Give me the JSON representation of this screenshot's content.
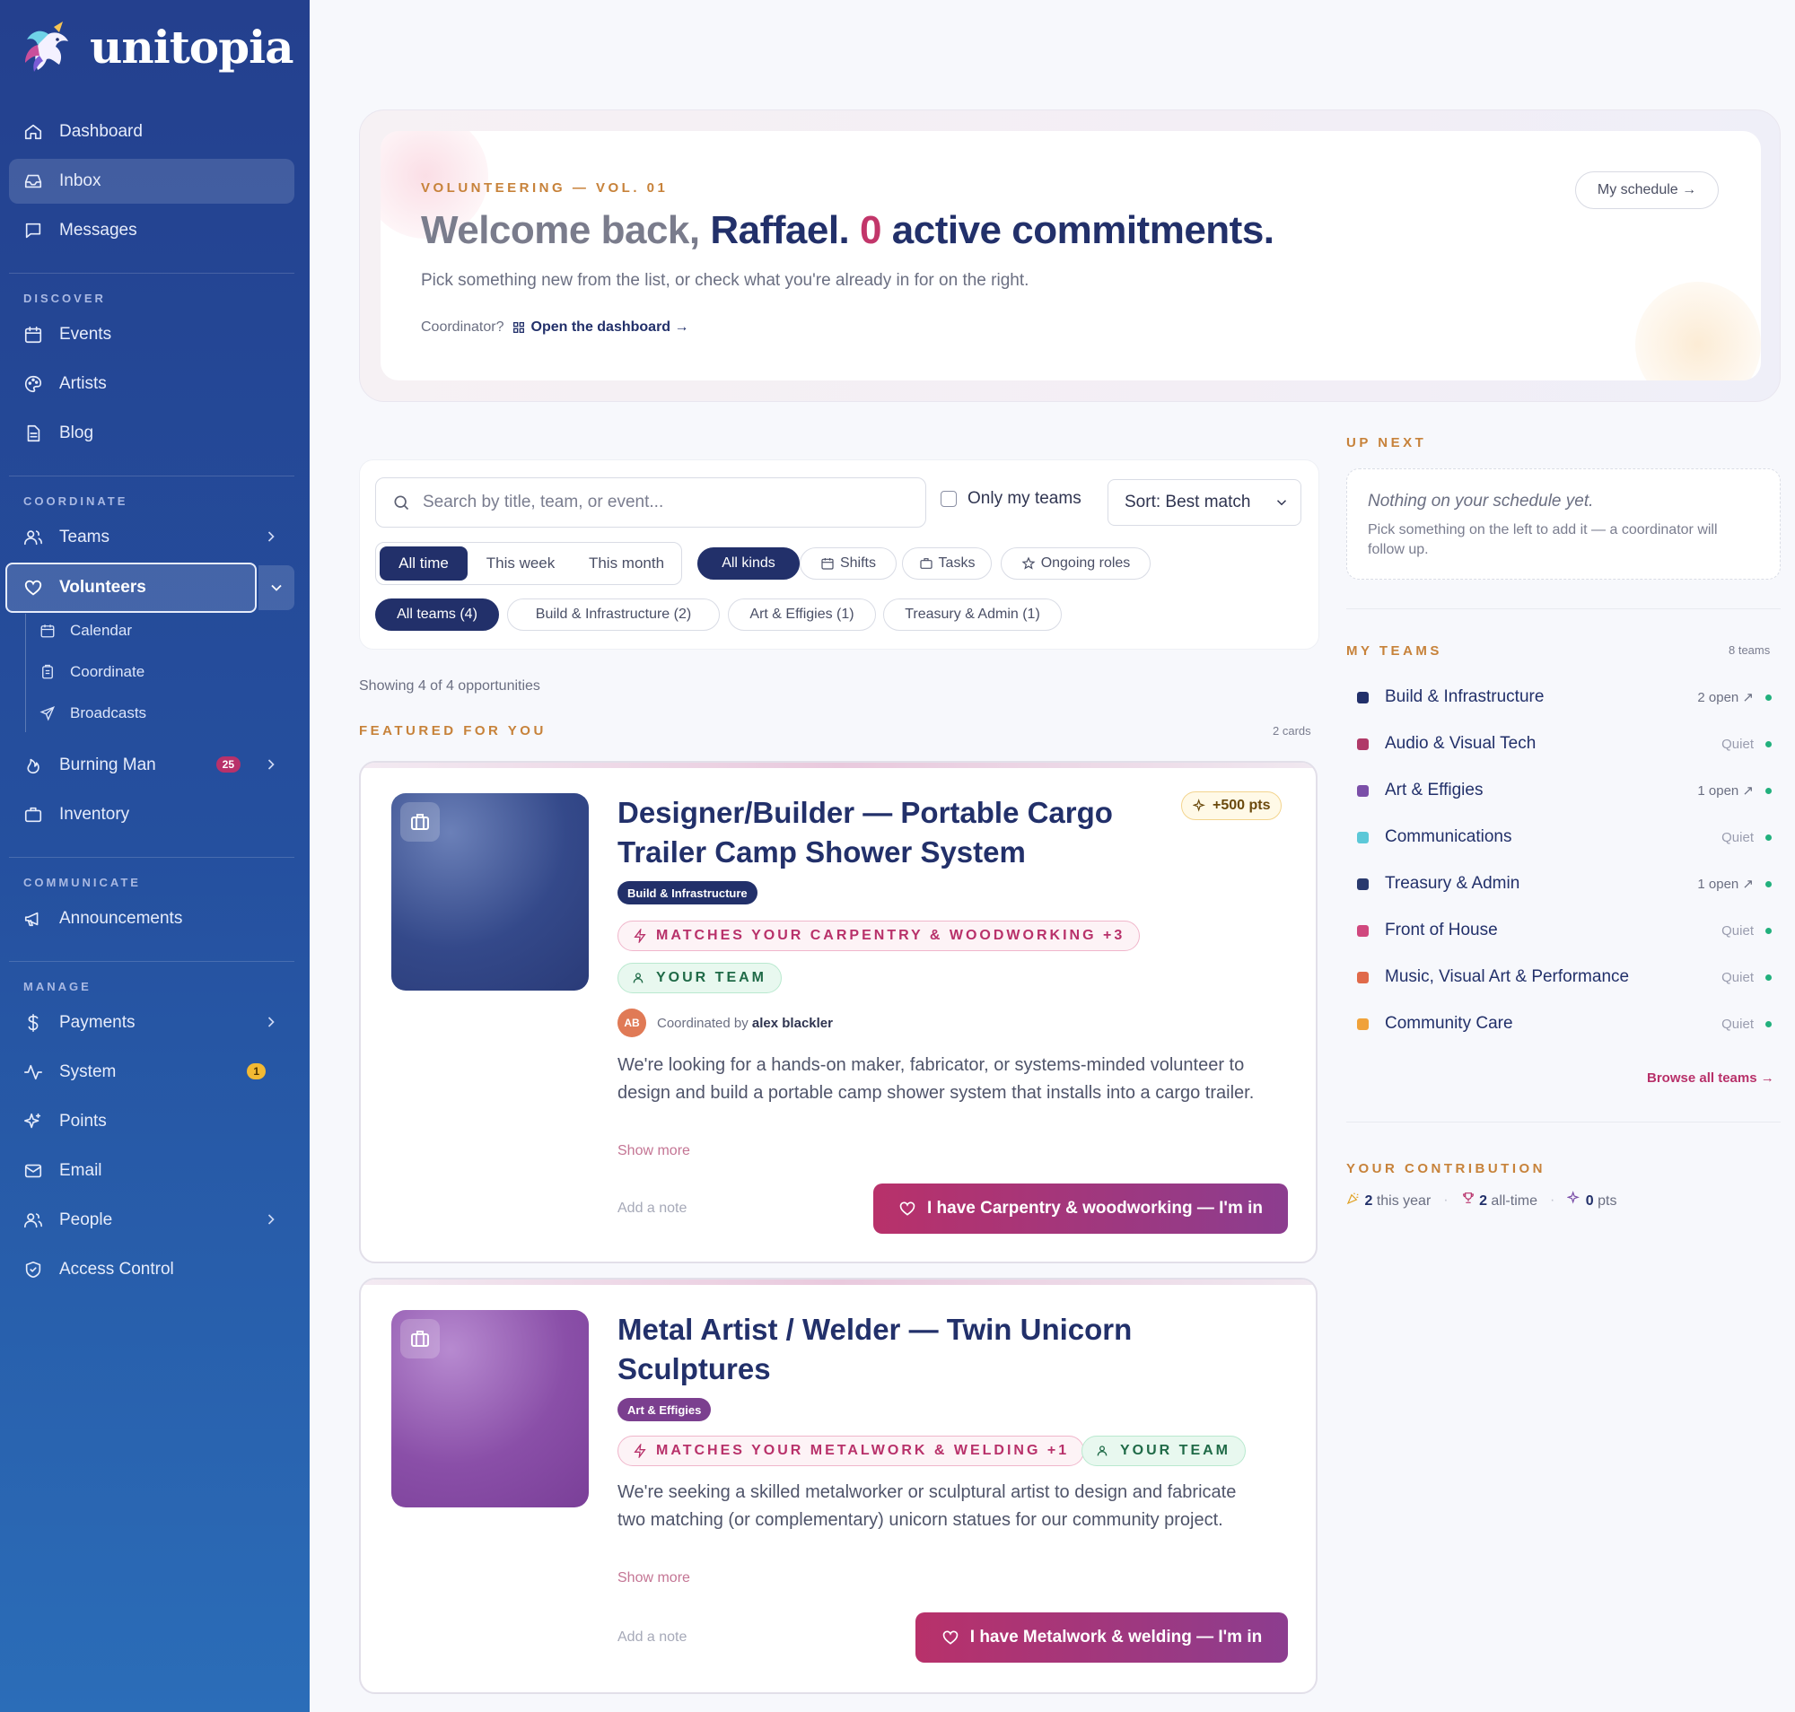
{
  "brand": {
    "name": "unitopia"
  },
  "sidebar": {
    "top": [
      {
        "label": "Dashboard",
        "icon": "home-icon"
      },
      {
        "label": "Inbox",
        "icon": "inbox-icon"
      },
      {
        "label": "Messages",
        "icon": "message-icon"
      }
    ],
    "sections": {
      "discover": "DISCOVER",
      "coordinate": "COORDINATE",
      "communicate": "COMMUNICATE",
      "manage": "MANAGE"
    },
    "discover": [
      {
        "label": "Events",
        "icon": "calendar-icon"
      },
      {
        "label": "Artists",
        "icon": "palette-icon"
      },
      {
        "label": "Blog",
        "icon": "document-icon"
      }
    ],
    "coordinate": {
      "teams": "Teams",
      "volunteers": "Volunteers",
      "sub": [
        "Calendar",
        "Coordinate",
        "Broadcasts"
      ],
      "burning_man": "Burning Man",
      "burning_man_badge": "25",
      "inventory": "Inventory"
    },
    "communicate": {
      "announcements": "Announcements"
    },
    "manage": {
      "payments": "Payments",
      "system": "System",
      "system_badge": "1",
      "points": "Points",
      "email": "Email",
      "people": "People",
      "access": "Access Control"
    }
  },
  "hero": {
    "eyebrow": "VOLUNTEERING — VOL. 01",
    "welcome": "Welcome back,",
    "name": "Raffael.",
    "count": "0",
    "rest": "active commitments.",
    "subtitle": "Pick something new from the list, or check what you're already in for on the right.",
    "coordinator_prompt": "Coordinator?",
    "coordinator_link": "Open the dashboard →",
    "schedule_button": "My schedule →"
  },
  "filters": {
    "search_placeholder": "Search by title, team, or event...",
    "only_my_teams": "Only my teams",
    "sort": "Sort: Best match",
    "time": [
      "All time",
      "This week",
      "This month"
    ],
    "kinds": [
      "All kinds",
      "Shifts",
      "Tasks",
      "Ongoing roles"
    ],
    "teams": [
      "All teams (4)",
      "Build & Infrastructure (2)",
      "Art & Effigies (1)",
      "Treasury & Admin (1)"
    ]
  },
  "listing": {
    "showing": "Showing 4 of 4 opportunities",
    "featured_label": "FEATURED FOR YOU",
    "featured_count": "2 cards"
  },
  "cards": [
    {
      "title_line1": "Designer/Builder — Portable Cargo",
      "title_line2": "Trailer Camp Shower System",
      "team": "Build & Infrastructure",
      "team_color": "#22306a",
      "match": "MATCHES YOUR CARPENTRY & WOODWORKING +3",
      "your_team": "YOUR TEAM",
      "points": "+500 pts",
      "avatar": "AB",
      "coordinated_by": "Coordinated by",
      "coordinator": "alex blackler",
      "desc": "We're looking for a hands-on maker, fabricator, or systems-minded volunteer to design and build a portable camp shower system that installs into a cargo trailer.",
      "show_more": "Show more",
      "add_note": "Add a note",
      "cta": "I have Carpentry & woodworking — I'm in"
    },
    {
      "title_line1": "Metal Artist / Welder — Twin Unicorn",
      "title_line2": "Sculptures",
      "team": "Art & Effigies",
      "team_color": "#7b3f8f",
      "match": "MATCHES YOUR METALWORK & WELDING +1",
      "your_team": "YOUR TEAM",
      "desc": "We're seeking a skilled metalworker or sculptural artist to design and fabricate two matching (or complementary) unicorn statues for our community project.",
      "show_more": "Show more",
      "add_note": "Add a note",
      "cta": "I have Metalwork & welding — I'm in"
    }
  ],
  "right": {
    "up_next_label": "UP NEXT",
    "up_next_title": "Nothing on your schedule yet.",
    "up_next_sub": "Pick something on the left to add it — a coordinator will follow up.",
    "my_teams_label": "MY TEAMS",
    "my_teams_count": "8 teams",
    "teams": [
      {
        "name": "Build & Infrastructure",
        "status": "2 open ↗",
        "color": "#22306a"
      },
      {
        "name": "Audio & Visual Tech",
        "status": "Quiet",
        "color": "#b03a68"
      },
      {
        "name": "Art & Effigies",
        "status": "1 open ↗",
        "color": "#7b4fa8"
      },
      {
        "name": "Communications",
        "status": "Quiet",
        "color": "#5cc8d8"
      },
      {
        "name": "Treasury & Admin",
        "status": "1 open ↗",
        "color": "#2a3a6e"
      },
      {
        "name": "Front of House",
        "status": "Quiet",
        "color": "#d0487e"
      },
      {
        "name": "Music, Visual Art & Performance",
        "status": "Quiet",
        "color": "#e06a4a"
      },
      {
        "name": "Community Care",
        "status": "Quiet",
        "color": "#f0a23a"
      }
    ],
    "browse": "Browse all teams →",
    "contribution_label": "YOUR CONTRIBUTION",
    "this_year_n": "2",
    "this_year": "this year",
    "all_time_n": "2",
    "all_time": "all-time",
    "pts_n": "0",
    "pts": "pts"
  }
}
